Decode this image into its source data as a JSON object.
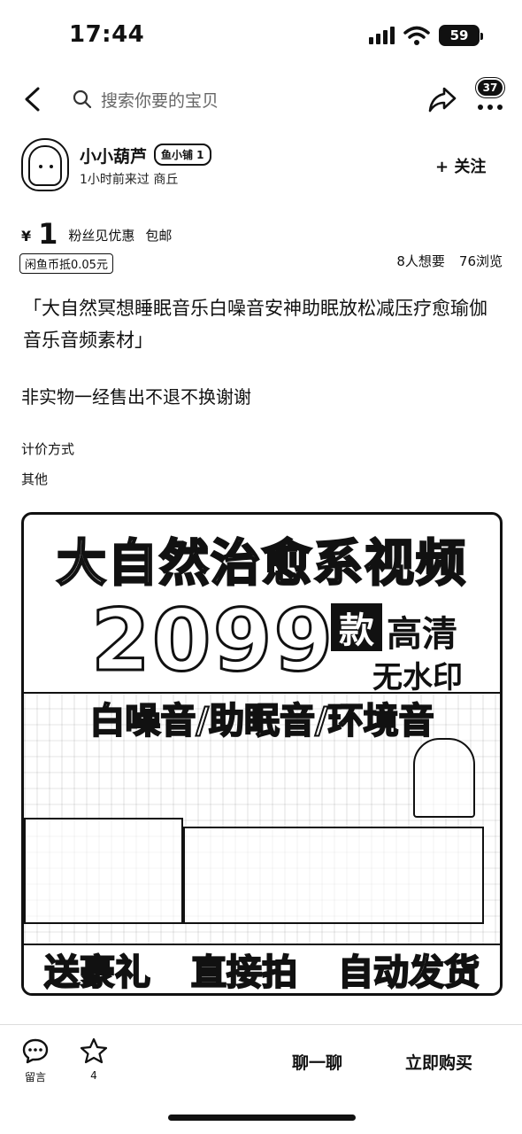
{
  "status": {
    "time": "17:44",
    "battery": "59"
  },
  "nav": {
    "search_placeholder": "搜索你要的宝贝",
    "badge": "37"
  },
  "seller": {
    "name": "小小葫芦",
    "tag": "鱼小铺 1",
    "meta": "1小时前来过  商丘",
    "follow_label": "+ 关注"
  },
  "price": {
    "currency": "¥",
    "value": "1",
    "note": "粉丝见优惠",
    "shipping": "包邮",
    "coin": "闲鱼币抵0.05元",
    "wants": "8人想要",
    "views": "76浏览"
  },
  "item": {
    "title": "「大自然冥想睡眠音乐白噪音安神助眠放松减压疗愈瑜伽音乐音频素材」",
    "desc": "非实物一经售出不退不换谢谢",
    "price_method_label": "计价方式",
    "price_method_value": "其他"
  },
  "banner": {
    "line1": "大自然治愈系视频",
    "count": "2099",
    "kuan": "款",
    "hd": "高清",
    "no_watermark": "无水印",
    "line2": "白噪音/助眠音/环境音",
    "bottom": [
      "送豪礼",
      "直接拍",
      "自动发货"
    ]
  },
  "bottom_bar": {
    "message_label": "留言",
    "fav_count": "4",
    "chat_label": "聊一聊",
    "buy_label": "立即购买"
  }
}
